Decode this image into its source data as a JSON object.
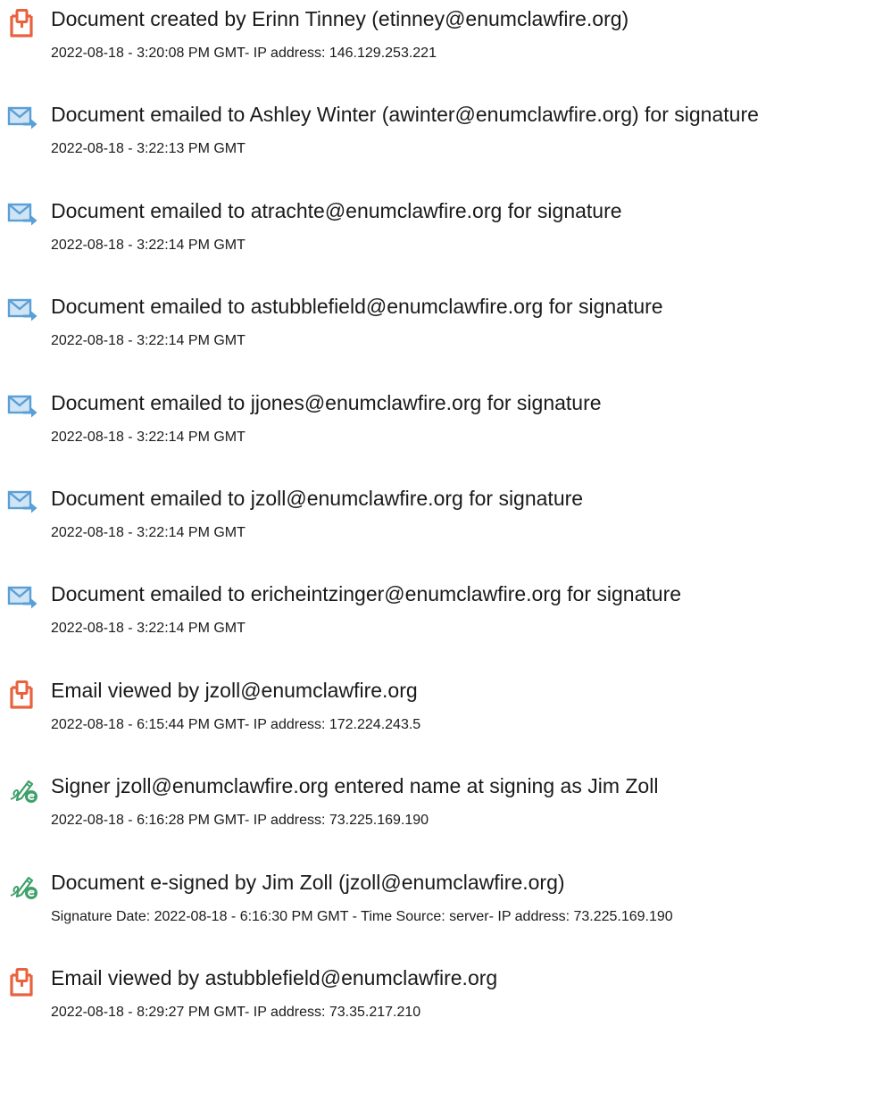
{
  "colors": {
    "document_icon": "#e8623e",
    "email_icon": "#5a9fd6",
    "sign_icon": "#3fa06a"
  },
  "events": [
    {
      "icon": "document-icon",
      "title": "Document created by Erinn Tinney (etinney@enumclawfire.org)",
      "detail": "2022-08-18 - 3:20:08 PM GMT- IP address: 146.129.253.221"
    },
    {
      "icon": "email-sent-icon",
      "title": "Document emailed to Ashley Winter (awinter@enumclawfire.org) for signature",
      "detail": "2022-08-18 - 3:22:13 PM GMT"
    },
    {
      "icon": "email-sent-icon",
      "title": "Document emailed to atrachte@enumclawfire.org for signature",
      "detail": "2022-08-18 - 3:22:14 PM GMT"
    },
    {
      "icon": "email-sent-icon",
      "title": "Document emailed to astubblefield@enumclawfire.org for signature",
      "detail": "2022-08-18 - 3:22:14 PM GMT"
    },
    {
      "icon": "email-sent-icon",
      "title": "Document emailed to jjones@enumclawfire.org for signature",
      "detail": "2022-08-18 - 3:22:14 PM GMT"
    },
    {
      "icon": "email-sent-icon",
      "title": "Document emailed to jzoll@enumclawfire.org for signature",
      "detail": "2022-08-18 - 3:22:14 PM GMT"
    },
    {
      "icon": "email-sent-icon",
      "title": "Document emailed to ericheintzinger@enumclawfire.org for signature",
      "detail": "2022-08-18 - 3:22:14 PM GMT"
    },
    {
      "icon": "document-icon",
      "title": "Email viewed by jzoll@enumclawfire.org",
      "detail": "2022-08-18 - 6:15:44 PM GMT- IP address: 172.224.243.5"
    },
    {
      "icon": "e-sign-icon",
      "title": "Signer jzoll@enumclawfire.org entered name at signing as Jim Zoll",
      "detail": "2022-08-18 - 6:16:28 PM GMT- IP address: 73.225.169.190"
    },
    {
      "icon": "e-sign-icon",
      "title": "Document e-signed by Jim Zoll (jzoll@enumclawfire.org)",
      "detail": "Signature Date: 2022-08-18 - 6:16:30 PM GMT - Time Source: server- IP address: 73.225.169.190"
    },
    {
      "icon": "document-icon",
      "title": "Email viewed by astubblefield@enumclawfire.org",
      "detail": "2022-08-18 - 8:29:27 PM GMT- IP address: 73.35.217.210"
    }
  ]
}
